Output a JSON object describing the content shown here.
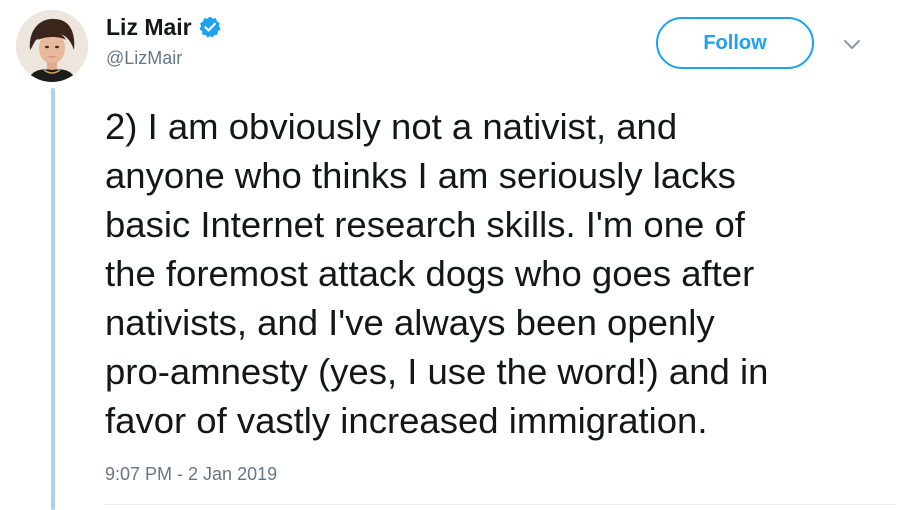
{
  "tweet": {
    "author": {
      "display_name": "Liz Mair",
      "handle": "@LizMair",
      "verified": true
    },
    "follow_label": "Follow",
    "text": "2) I am obviously not a nativist, and\nanyone who thinks I am seriously lacks\nbasic Internet research skills. I'm one of\nthe foremost attack dogs who goes after\nnativists, and I've always been openly\npro-amnesty (yes, I use the word!) and in\nfavor of vastly increased immigration.",
    "timestamp": "9:07 PM - 2 Jan 2019"
  },
  "colors": {
    "accent": "#1da1f2",
    "thread_line": "#a8d3eb",
    "secondary_text": "#657786",
    "primary_text": "#14171a"
  },
  "icons": {
    "verified": "verified-badge-icon",
    "menu": "chevron-down-icon"
  }
}
